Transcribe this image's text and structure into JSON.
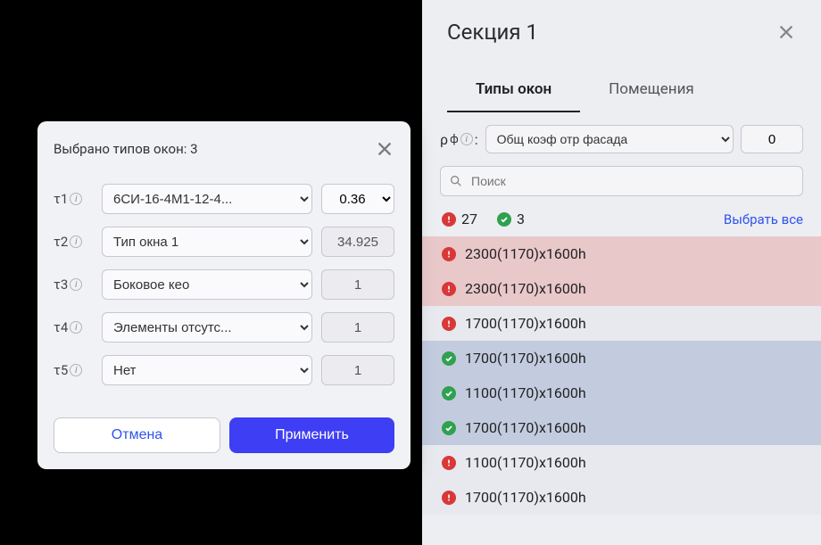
{
  "panel": {
    "title": "Секция 1",
    "tabs": [
      {
        "label": "Типы окон",
        "active": true
      },
      {
        "label": "Помещения",
        "active": false
      }
    ],
    "rho": {
      "label_prefix": "ρ",
      "label_sub": "ф",
      "select_value": "Общ коэф отр фасада",
      "number_value": "0",
      "search_placeholder": "Поиск"
    },
    "counters": {
      "red": "27",
      "green": "3",
      "select_all": "Выбрать все"
    },
    "items": [
      {
        "status": "red",
        "bg": "red-bg",
        "label": "2300(1170)x1600h"
      },
      {
        "status": "red",
        "bg": "red-bg",
        "label": "2300(1170)x1600h"
      },
      {
        "status": "red",
        "bg": "grey-bg",
        "label": "1700(1170)x1600h"
      },
      {
        "status": "green",
        "bg": "blue-bg",
        "label": "1700(1170)x1600h"
      },
      {
        "status": "green",
        "bg": "blue-bg",
        "label": "1100(1170)x1600h"
      },
      {
        "status": "green",
        "bg": "blue-bg",
        "label": "1700(1170)x1600h"
      },
      {
        "status": "red",
        "bg": "grey-bg",
        "label": "1100(1170)x1600h"
      },
      {
        "status": "red",
        "bg": "grey-bg",
        "label": "1700(1170)x1600h"
      }
    ]
  },
  "modal": {
    "title": "Выбрано типов окон: 3",
    "rows": [
      {
        "label": "τ1",
        "select": "6СИ-16-4М1-12-4...",
        "value": "0.36",
        "value_type": "select"
      },
      {
        "label": "τ2",
        "select": "Тип окна 1",
        "value": "34.925",
        "value_type": "readonly"
      },
      {
        "label": "τ3",
        "select": "Боковое кео",
        "value": "1",
        "value_type": "readonly"
      },
      {
        "label": "τ4",
        "select": "Элементы отсутс...",
        "value": "1",
        "value_type": "readonly"
      },
      {
        "label": "τ5",
        "select": "Нет",
        "value": "1",
        "value_type": "readonly"
      }
    ],
    "cancel": "Отмена",
    "apply": "Применить"
  }
}
